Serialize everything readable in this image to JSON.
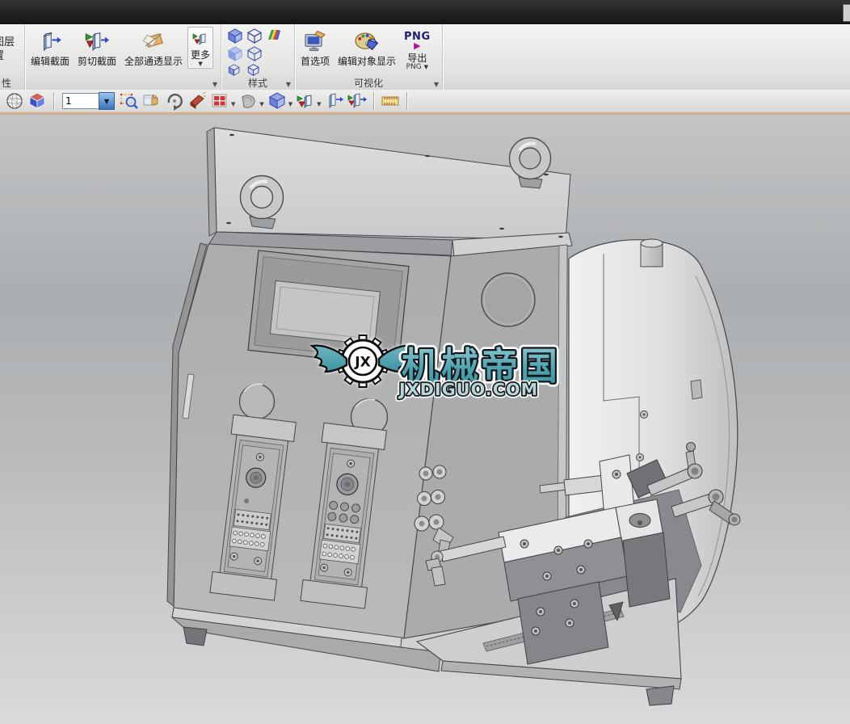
{
  "titlebar": {
    "note": ""
  },
  "ui": {
    "arrow_down": "▼",
    "launcher": "▼"
  },
  "ribbon": {
    "clipped_group": {
      "line1": "图层",
      "line2": "置",
      "group_label": "性"
    },
    "section_group": {
      "edit_section": "编辑截面",
      "clip_section": "剪切截面",
      "show_all_translucent": "全部通透显示",
      "more": "更多"
    },
    "style_group": {
      "label": "样式"
    },
    "visualization_group": {
      "preferences": "首选项",
      "edit_object_display": "编辑对象显示",
      "export_label": "导出",
      "export_sub": "PNG",
      "png_icon_text": "PNG",
      "label": "可视化"
    }
  },
  "toolbar2": {
    "layer_value": "1",
    "icons": [
      "wireframe-sphere",
      "shaded-cube",
      "layer-dropdown",
      "zoom-box",
      "pan-hand",
      "rotate",
      "eraser",
      "red-grid",
      "shell-solid",
      "style-cube",
      "colored-section",
      "edit-section-slab",
      "clip-section-slab",
      "ruler"
    ]
  },
  "watermark": {
    "logo_text": "JX",
    "title": "机械帝国",
    "url": "JXDIGUO.COM",
    "teal": "#4fa3b1"
  },
  "colors": {
    "accent_line": "#e2a876",
    "png_navy": "#1c1c78",
    "magenta_triangle": "#bb0e9a",
    "viewport_top": "#c2c4c6",
    "viewport_bottom": "#d9dadb"
  }
}
